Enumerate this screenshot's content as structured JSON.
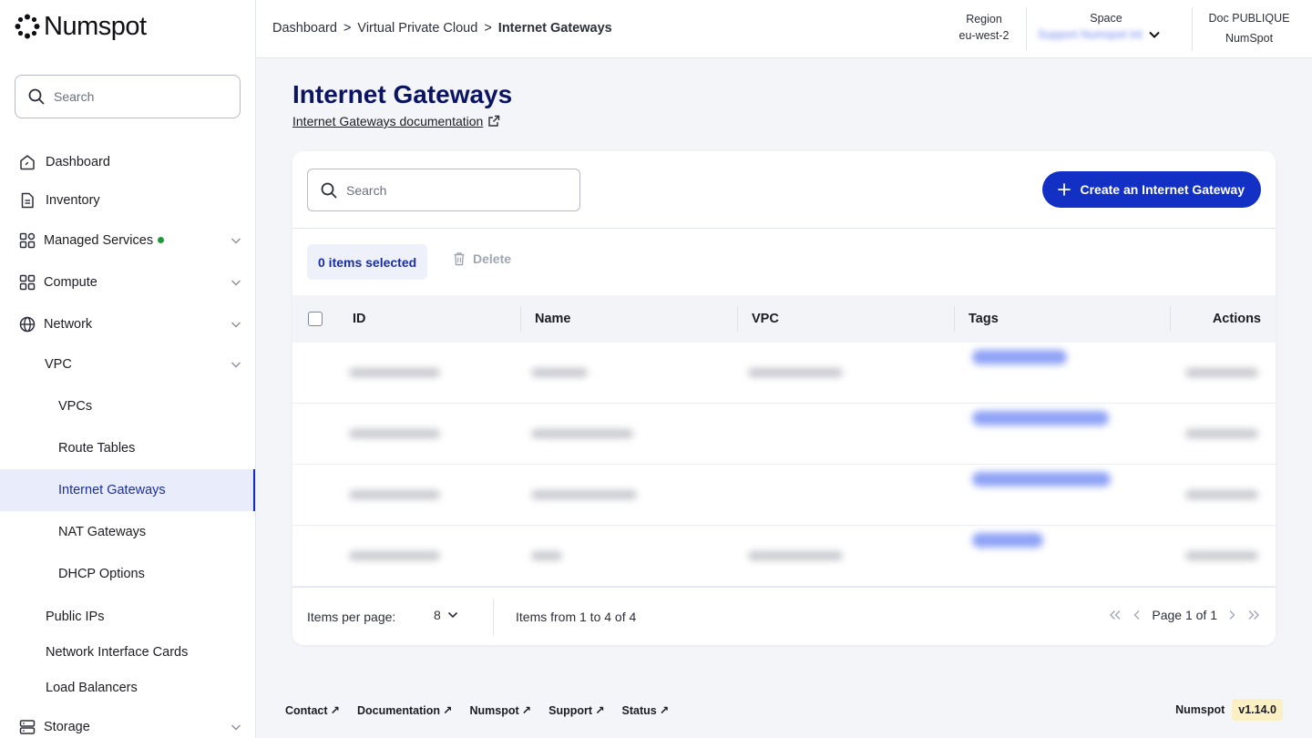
{
  "app": {
    "logo_text": "Numspot"
  },
  "sidebar": {
    "search_placeholder": "Search",
    "items": [
      {
        "label": "Dashboard"
      },
      {
        "label": "Inventory"
      },
      {
        "label": "Managed Services"
      },
      {
        "label": "Compute"
      },
      {
        "label": "Network"
      },
      {
        "label": "VPC"
      },
      {
        "label": "VPCs"
      },
      {
        "label": "Route Tables"
      },
      {
        "label": "Internet Gateways"
      },
      {
        "label": "NAT Gateways"
      },
      {
        "label": "DHCP Options"
      },
      {
        "label": "Public IPs"
      },
      {
        "label": "Network Interface Cards"
      },
      {
        "label": "Load Balancers"
      },
      {
        "label": "Storage"
      }
    ],
    "accent_color": "#1330c5",
    "status_dot_color": "#1e9b3a"
  },
  "header": {
    "breadcrumb": [
      "Dashboard",
      "Virtual Private Cloud",
      "Internet Gateways"
    ],
    "breadcrumb_sep": ">",
    "region_label": "Region",
    "region_value": "eu-west-2",
    "space_label": "Space",
    "space_value": "Support Numspot Int",
    "doc_label": "Doc PUBLIQUE",
    "doc_value": "NumSpot"
  },
  "main": {
    "title": "Internet Gateways",
    "doc_link": "Internet Gateways documentation",
    "search_placeholder": "Search",
    "create_button": "Create an Internet Gateway",
    "selected_text": "0 items selected",
    "delete_label": "Delete",
    "columns": [
      "ID",
      "Name",
      "VPC",
      "Tags",
      "Actions"
    ],
    "row_count": 4
  },
  "pagination": {
    "items_per_page_label": "Items per page:",
    "items_per_page_value": "8",
    "range_text": "Items from 1 to 4 of 4",
    "page_text": "Page 1 of 1"
  },
  "footer": {
    "links": [
      "Contact",
      "Documentation",
      "Numspot",
      "Support",
      "Status"
    ],
    "brand": "Numspot",
    "version": "v1.14.0"
  }
}
